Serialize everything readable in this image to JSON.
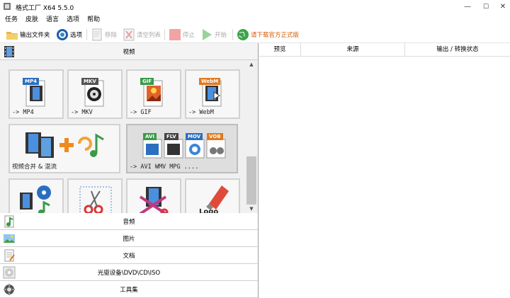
{
  "window": {
    "title": "格式工厂 X64 5.5.0",
    "minimize": "—",
    "maximize": "☐",
    "close": "✕"
  },
  "menu": [
    "任务",
    "皮肤",
    "语言",
    "选项",
    "帮助"
  ],
  "toolbar": {
    "output_folder": "输出文件夹",
    "options": "选项",
    "remove": "移除",
    "clear_list": "清空列表",
    "stop": "停止",
    "start": "开始",
    "download": "请下载官方正式版"
  },
  "left": {
    "video_header": "视频",
    "tiles": [
      {
        "label": "-> MP4",
        "badge": "MP4",
        "color": "#2b6fc0"
      },
      {
        "label": "-> MKV",
        "badge": "MKV",
        "color": "#555555"
      },
      {
        "label": "-> GIF",
        "badge": "GIF",
        "color": "#3a9a4a"
      },
      {
        "label": "-> WebM",
        "badge": "WebM",
        "color": "#e07a1f"
      },
      {
        "label": "视频合并 & 混流"
      },
      {
        "label": "-> AVI WMV MPG ....",
        "badges": [
          "AVI",
          "FLV",
          "MOV",
          "VOB"
        ]
      }
    ],
    "categories": [
      "音频",
      "图片",
      "文档",
      "光驱设备\\DVD\\CD\\ISO",
      "工具集"
    ]
  },
  "table": {
    "columns": [
      "预览",
      "来源",
      "输出 / 转换状态"
    ]
  },
  "colors": {
    "border": "#d2d2d2",
    "selected_tile": "#dedede",
    "warn_text": "#d85a00"
  }
}
